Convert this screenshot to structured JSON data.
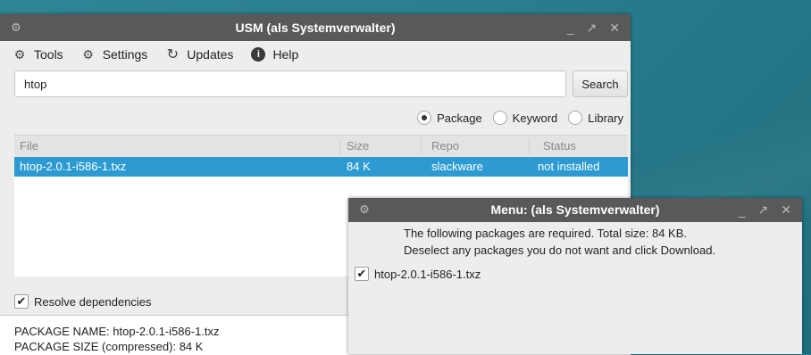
{
  "main_window": {
    "title": "USM (als Systemverwalter)",
    "controls": [
      "_",
      "↗",
      "✕"
    ],
    "toolbar": {
      "tools_label": "Tools",
      "settings_label": "Settings",
      "updates_label": "Updates",
      "help_label": "Help"
    },
    "search": {
      "value": "htop",
      "button_label": "Search"
    },
    "search_mode": {
      "options": [
        "Package",
        "Keyword",
        "Library"
      ],
      "selected": "Package"
    },
    "table": {
      "columns": [
        "File",
        "Size",
        "Repo",
        "Status"
      ],
      "rows": [
        {
          "file": "htop-2.0.1-i586-1.txz",
          "size": "84 K",
          "repo": "slackware",
          "status": "not installed",
          "selected": true
        }
      ]
    },
    "resolve_dependencies": {
      "label": "Resolve dependencies",
      "checked": true
    },
    "info": {
      "package_name": "PACKAGE NAME:  htop-2.0.1-i586-1.txz",
      "package_size": "PACKAGE SIZE (compressed):  84 K"
    }
  },
  "dialog": {
    "title": "Menu:  (als Systemverwalter)",
    "controls": [
      "_",
      "↗",
      "✕"
    ],
    "message_line1": "The following packages are required. Total size: 84 KB.",
    "message_line2": "Deselect any packages you do not want and click Download.",
    "packages": [
      {
        "name": "htop-2.0.1-i586-1.txz",
        "checked": true
      }
    ]
  },
  "colors": {
    "titlebar": "#595959",
    "selection": "#2d9bd2",
    "desktop": "#2c7f91"
  }
}
